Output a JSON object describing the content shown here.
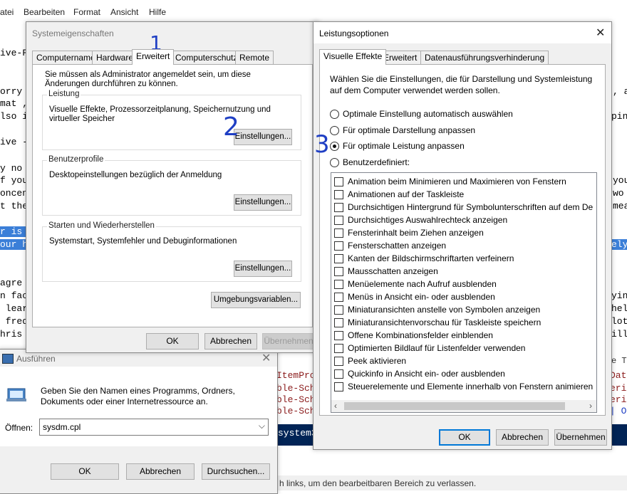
{
  "menubar": {
    "items": [
      "atei",
      "Bearbeiten",
      "Format",
      "Ansicht",
      "Hilfe"
    ]
  },
  "editor": {
    "left_fragments": [
      "ive-F",
      "orry",
      "mat ,",
      "lso i",
      "ive -",
      "y no",
      "f you",
      "oncen",
      "t the",
      "r is",
      "our h",
      "agre",
      "n fac",
      " lear",
      " freq",
      "hris"
    ],
    "right_fragments": [
      ", an",
      "ping",
      "you",
      "wo",
      "mea",
      "ely",
      "ying",
      "hell",
      "lot",
      "ill"
    ],
    "lower_fragments": [
      "ItemPro",
      "ble-Sch",
      "ble-Sch",
      "ble-Sch"
    ],
    "lower_right": [
      "Data",
      "eri",
      "eri",
      "| O"
    ],
    "dark_text": "system3",
    "status_text": "h links, um den bearbeitbaren Bereich zu verlassen.",
    "right_edge_fragment": "e T"
  },
  "sysprops": {
    "title": "Systemeigenschaften",
    "tabs": [
      "Computername",
      "Hardware",
      "Erweitert",
      "Computerschutz",
      "Remote"
    ],
    "admin_note": "Sie müssen als Administrator angemeldet sein, um diese Änderungen durchführen zu können.",
    "groups": [
      {
        "label": "Leistung",
        "desc": "Visuelle Effekte, Prozessorzeitplanung, Speichernutzung und virtueller Speicher",
        "button": "Einstellungen..."
      },
      {
        "label": "Benutzerprofile",
        "desc": "Desktopeinstellungen bezüglich der Anmeldung",
        "button": "Einstellungen..."
      },
      {
        "label": "Starten und Wiederherstellen",
        "desc": "Systemstart, Systemfehler und Debuginformationen",
        "button": "Einstellungen..."
      }
    ],
    "env_button": "Umgebungsvariablen...",
    "ok": "OK",
    "cancel": "Abbrechen",
    "apply": "Übernehmen"
  },
  "run": {
    "title": "Ausführen",
    "desc": "Geben Sie den Namen eines Programms, Ordners, Dokuments oder einer Internetressource an.",
    "open_label": "Öffnen:",
    "open_value": "sysdm.cpl",
    "ok": "OK",
    "cancel": "Abbrechen",
    "browse": "Durchsuchen..."
  },
  "perf": {
    "title": "Leistungsoptionen",
    "tabs": [
      "Visuelle Effekte",
      "Erweitert",
      "Datenausführungsverhinderung"
    ],
    "intro": "Wählen Sie die Einstellungen, die für Darstellung und Systemleistung auf dem Computer verwendet werden sollen.",
    "radios": [
      {
        "label": "Optimale Einstellung automatisch auswählen",
        "checked": false
      },
      {
        "label": "Für optimale Darstellung anpassen",
        "checked": false
      },
      {
        "label": "Für optimale Leistung anpassen",
        "checked": true
      },
      {
        "label": "Benutzerdefiniert:",
        "checked": false
      }
    ],
    "effects": [
      "Animation beim Minimieren und Maximieren von Fenstern",
      "Animationen auf der Taskleiste",
      "Durchsichtigen Hintergrund für Symbolunterschriften auf dem De",
      "Durchsichtiges Auswahlrechteck anzeigen",
      "Fensterinhalt beim Ziehen anzeigen",
      "Fensterschatten anzeigen",
      "Kanten der Bildschirmschriftarten verfeinern",
      "Mausschatten anzeigen",
      "Menüelemente nach Aufruf ausblenden",
      "Menüs in Ansicht ein- oder ausblenden",
      "Miniaturansichten anstelle von Symbolen anzeigen",
      "Miniaturansichtenvorschau für Taskleiste speichern",
      "Offene Kombinationsfelder einblenden",
      "Optimierten Bildlauf für Listenfelder verwenden",
      "Peek aktivieren",
      "Quickinfo in Ansicht ein- oder ausblenden",
      "Steuerelemente und Elemente innerhalb von Fenstern animieren"
    ],
    "ok": "OK",
    "cancel": "Abbrechen",
    "apply": "Übernehmen"
  },
  "annotations": {
    "one": "1",
    "two": "2",
    "three": "3"
  },
  "colors": {
    "annotation": "#1f3fc4",
    "highlight": "#3b7fd8",
    "powershell": "#012456"
  },
  "icons": {
    "close": "close-icon",
    "run": "run-icon",
    "dropdown": "chevron-down-icon"
  }
}
